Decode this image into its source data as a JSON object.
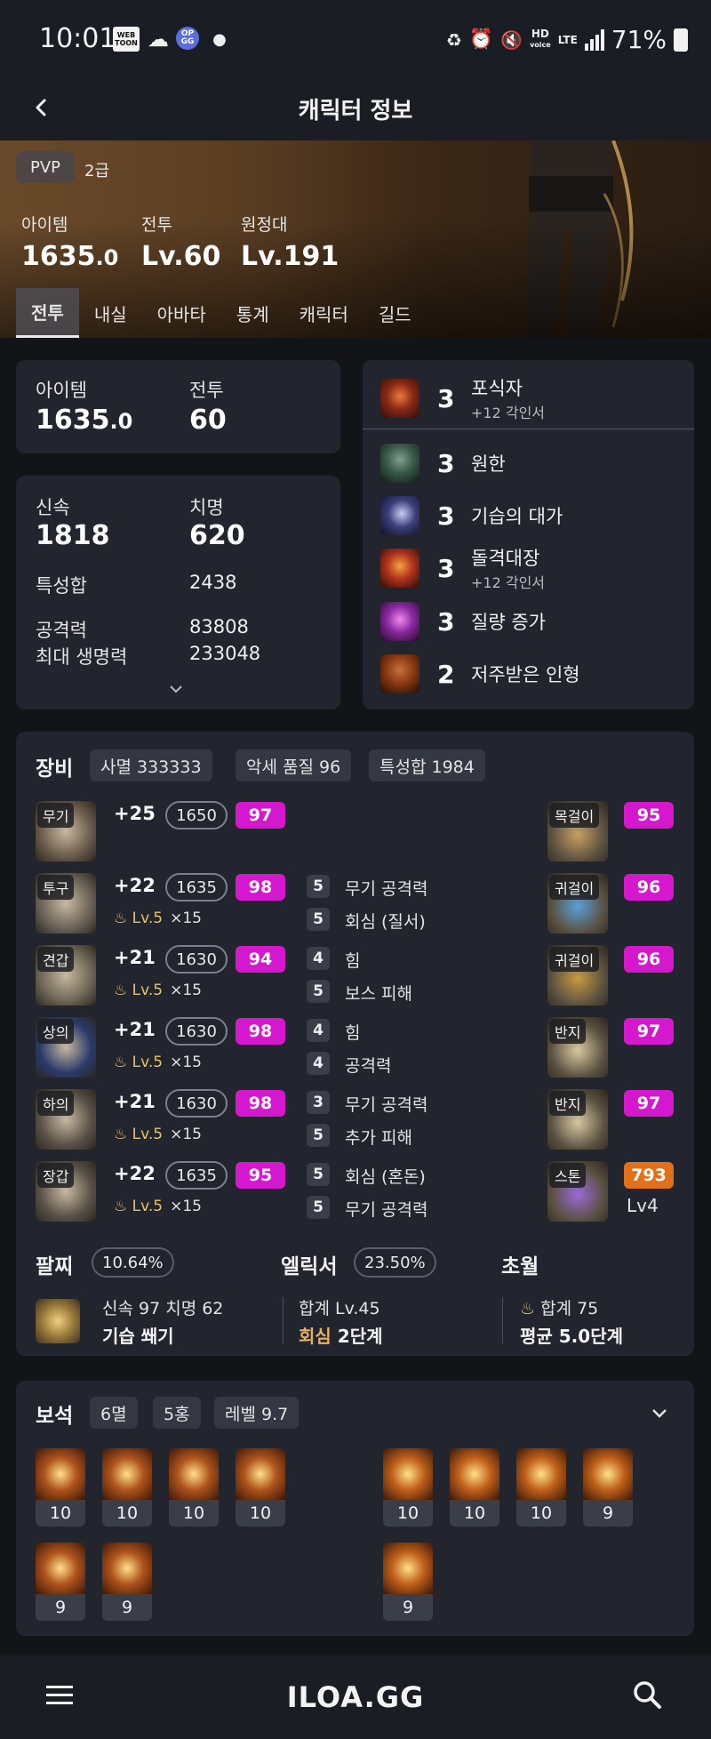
{
  "status_bar": {
    "time": "10:01",
    "battery": "71%",
    "icons": [
      "webtoon-icon",
      "cloud-icon",
      "opgg-icon",
      "dot-icon",
      "battery-saver-icon",
      "alarm-icon",
      "mute-icon",
      "hd-voice-icon",
      "lte-icon",
      "signal-icon",
      "battery-icon"
    ]
  },
  "status_icons_text": {
    "webtoon_1": "WEB",
    "webtoon_2": "TOON",
    "opgg_1": "OP",
    "opgg_2": "GG",
    "hd": "HD",
    "voice": "voice",
    "lte": "LTE"
  },
  "header": {
    "title": "캐릭터 정보"
  },
  "hero": {
    "pvp_badge": "PVP",
    "pvp_grade": "2급",
    "stats": [
      {
        "label": "아이템",
        "value_main": "1635",
        "value_dec": ".0"
      },
      {
        "label": "전투",
        "value_main": "Lv.60",
        "value_dec": ""
      },
      {
        "label": "원정대",
        "value_main": "Lv.191",
        "value_dec": ""
      }
    ],
    "tabs": [
      "전투",
      "내실",
      "아바타",
      "통계",
      "캐릭터",
      "길드"
    ],
    "active_tab": "전투"
  },
  "level_card": {
    "item_label": "아이템",
    "item_main": "1635",
    "item_dec": ".0",
    "combat_label": "전투",
    "combat_value": "60"
  },
  "stats_card": {
    "swift_label": "신속",
    "swift_value": "1818",
    "crit_label": "치명",
    "crit_value": "620",
    "total_label": "특성합",
    "total_value": "2438",
    "atk_label": "공격력",
    "atk_value": "83808",
    "hp_label": "최대 생명력",
    "hp_value": "233048"
  },
  "engravings": [
    {
      "level": "3",
      "name": "포식자",
      "sub": "+12 각인서",
      "color": "#8a2a16"
    },
    {
      "level": "3",
      "name": "원한",
      "sub": "",
      "color": "#3a5a4a"
    },
    {
      "level": "3",
      "name": "기습의 대가",
      "sub": "",
      "color": "#3a3f7a"
    },
    {
      "level": "3",
      "name": "돌격대장",
      "sub": "+12 각인서",
      "color": "#b0341c"
    },
    {
      "level": "3",
      "name": "질량 증가",
      "sub": "",
      "color": "#8a2aa0"
    },
    {
      "level": "2",
      "name": "저주받은 인형",
      "sub": "",
      "color": "#8a3a12"
    }
  ],
  "equipment": {
    "title": "장비",
    "chips": [
      "사멸 333333",
      "악세 품질 96",
      "특성합 1984"
    ],
    "armor": [
      {
        "slot": "무기",
        "refine": "+25",
        "ilvl": "1650",
        "quality": "97",
        "transcend_lv": "",
        "transcend_x": "",
        "elixirs": []
      },
      {
        "slot": "투구",
        "refine": "+22",
        "ilvl": "1635",
        "quality": "98",
        "transcend_lv": "Lv.5",
        "transcend_x": "×15",
        "elixirs": [
          {
            "lv": "5",
            "name": "무기 공격력"
          },
          {
            "lv": "5",
            "name": "회심 (질서)"
          }
        ]
      },
      {
        "slot": "견갑",
        "refine": "+21",
        "ilvl": "1630",
        "quality": "94",
        "transcend_lv": "Lv.5",
        "transcend_x": "×15",
        "elixirs": [
          {
            "lv": "4",
            "name": "힘"
          },
          {
            "lv": "5",
            "name": "보스 피해"
          }
        ]
      },
      {
        "slot": "상의",
        "refine": "+21",
        "ilvl": "1630",
        "quality": "98",
        "transcend_lv": "Lv.5",
        "transcend_x": "×15",
        "elixirs": [
          {
            "lv": "4",
            "name": "힘"
          },
          {
            "lv": "4",
            "name": "공격력"
          }
        ]
      },
      {
        "slot": "하의",
        "refine": "+21",
        "ilvl": "1630",
        "quality": "98",
        "transcend_lv": "Lv.5",
        "transcend_x": "×15",
        "elixirs": [
          {
            "lv": "3",
            "name": "무기 공격력"
          },
          {
            "lv": "5",
            "name": "추가 피해"
          }
        ]
      },
      {
        "slot": "장갑",
        "refine": "+22",
        "ilvl": "1635",
        "quality": "95",
        "transcend_lv": "Lv.5",
        "transcend_x": "×15",
        "elixirs": [
          {
            "lv": "5",
            "name": "회심 (혼돈)"
          },
          {
            "lv": "5",
            "name": "무기 공격력"
          }
        ]
      }
    ],
    "accessories": [
      {
        "slot": "목걸이",
        "quality": "95"
      },
      {
        "slot": "귀걸이",
        "quality": "96"
      },
      {
        "slot": "귀걸이",
        "quality": "96"
      },
      {
        "slot": "반지",
        "quality": "97"
      },
      {
        "slot": "반지",
        "quality": "97"
      },
      {
        "slot": "스톤",
        "quality": "793",
        "sub": "Lv4"
      }
    ]
  },
  "bracelet": {
    "title": "팔찌",
    "pct": "10.64%",
    "line1": "신속 97  치명 62",
    "line2": "기습  쐐기"
  },
  "elixir": {
    "title": "엘릭서",
    "pct": "23.50%",
    "line1": "합계 Lv.45",
    "line2_accent": "회심",
    "line2_rest": "2단계"
  },
  "transcend": {
    "title": "초월",
    "line1": "합계 75",
    "line2": "평균 5.0단계"
  },
  "gems": {
    "title": "보석",
    "chips": [
      "6멸",
      "5홍",
      "레벨 9.7"
    ],
    "group_a": [
      "10",
      "10",
      "10",
      "10",
      "9",
      "9"
    ],
    "group_b": [
      "10",
      "10",
      "10",
      "9",
      "9"
    ]
  },
  "footer": {
    "logo": "ILOA.GG"
  }
}
